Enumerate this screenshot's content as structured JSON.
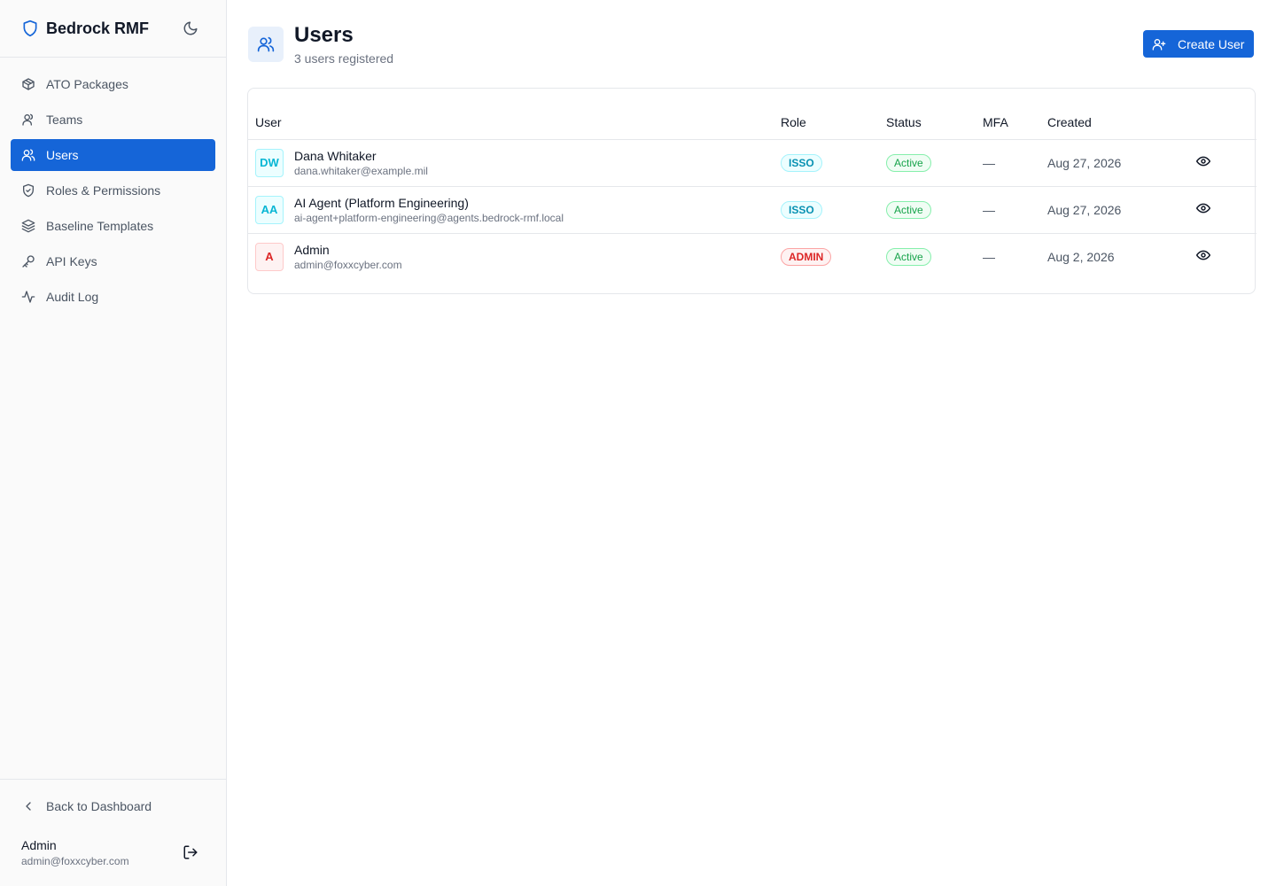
{
  "app": {
    "name": "Bedrock RMF"
  },
  "sidebar": {
    "items": [
      {
        "label": "ATO Packages",
        "icon": "package-icon",
        "active": false
      },
      {
        "label": "Teams",
        "icon": "user-icon",
        "active": false
      },
      {
        "label": "Users",
        "icon": "users-icon",
        "active": true
      },
      {
        "label": "Roles & Permissions",
        "icon": "shield-check-icon",
        "active": false
      },
      {
        "label": "Baseline Templates",
        "icon": "layers-icon",
        "active": false
      },
      {
        "label": "API Keys",
        "icon": "key-icon",
        "active": false
      },
      {
        "label": "Audit Log",
        "icon": "activity-icon",
        "active": false
      }
    ],
    "back_label": "Back to Dashboard",
    "account": {
      "name": "Admin",
      "email": "admin@foxxcyber.com"
    }
  },
  "page": {
    "title": "Users",
    "subtitle": "3 users registered",
    "create_label": "Create User"
  },
  "table": {
    "columns": [
      "User",
      "Role",
      "Status",
      "MFA",
      "Created",
      ""
    ],
    "rows": [
      {
        "initials": "DW",
        "name": "Dana Whitaker",
        "email": "dana.whitaker@example.mil",
        "role": "ISSO",
        "status": "Active",
        "mfa": "—",
        "created": "Aug 27, 2026"
      },
      {
        "initials": "AA",
        "name": "AI Agent (Platform Engineering)",
        "email": "ai-agent+platform-engineering@agents.bedrock-rmf.local",
        "role": "ISSO",
        "status": "Active",
        "mfa": "—",
        "created": "Aug 27, 2026"
      },
      {
        "initials": "A",
        "name": "Admin",
        "email": "admin@foxxcyber.com",
        "role": "ADMIN",
        "status": "Active",
        "mfa": "—",
        "created": "Aug 2, 2026"
      }
    ]
  },
  "colors": {
    "accent": "#1565d8",
    "sidebar_bg": "#fafafa",
    "isso": "#0891b2",
    "admin": "#dc2626",
    "active": "#16a34a"
  }
}
